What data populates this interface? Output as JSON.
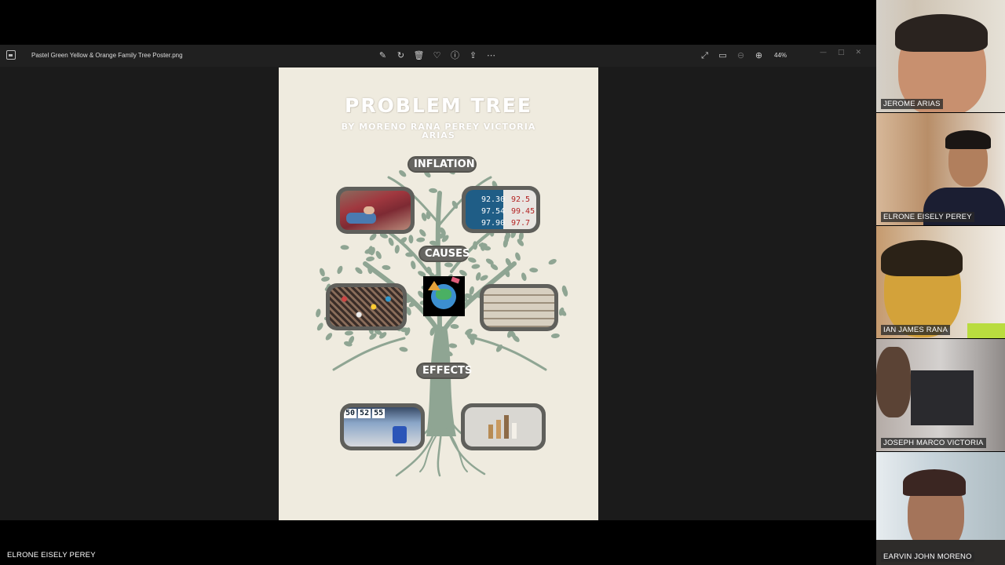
{
  "viewer": {
    "file_name": "Pastel Green Yellow & Orange Family Tree Poster.png",
    "zoom": "44%",
    "icons": [
      "edit-image-icon",
      "rotate-icon",
      "delete-icon",
      "favorite-icon",
      "info-icon",
      "share-icon",
      "more-icon"
    ],
    "right_icons": [
      "fullscreen-icon",
      "fit-icon",
      "zoom-out-icon",
      "zoom-in-icon"
    ],
    "window": {
      "minimize": "—",
      "maximize": "□",
      "close": "✕"
    }
  },
  "poster": {
    "title": "PROBLEM TREE",
    "subtitle_line1": "BY MORENO RANA PEREY VICTORIA",
    "subtitle_line2": "ARIAS",
    "labels": {
      "top": "INFLATION",
      "middle": "CAUSES",
      "bottom": "EFFECTS"
    },
    "price_board_left": [
      "92.30",
      "97.54",
      "97.90"
    ],
    "price_board_right": [
      "92.5",
      "99.45",
      "97.7"
    ],
    "sale_tags": [
      "50",
      "52",
      "55"
    ],
    "colors": {
      "background": "#efebdf",
      "tree": "#8fa593",
      "label": "#666561"
    }
  },
  "participants": [
    {
      "name": "JEROME ARIAS"
    },
    {
      "name": "ELRONE EISELY PEREY"
    },
    {
      "name": "IAN JAMES RANA"
    },
    {
      "name": "JOSEPH MARCO VICTORIA"
    },
    {
      "name": "EARVIN JOHN MORENO"
    }
  ],
  "presenter": {
    "name": "ELRONE EISELY PEREY"
  }
}
